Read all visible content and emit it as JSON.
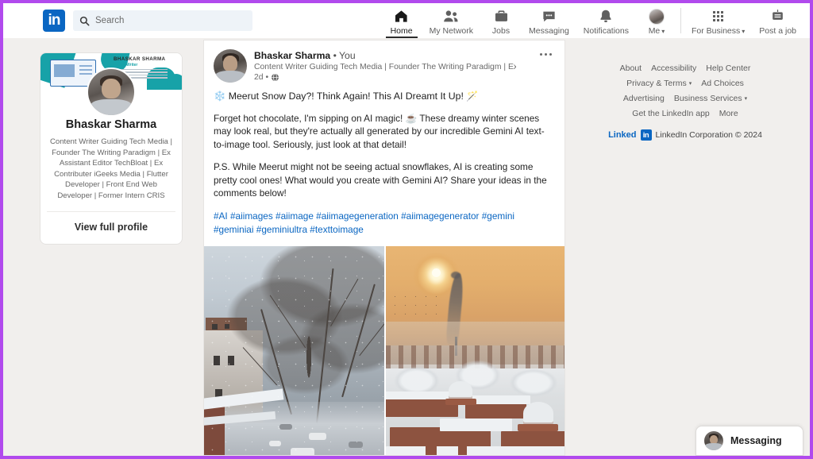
{
  "header": {
    "logo_text": "in",
    "search": {
      "placeholder": "Search",
      "value": ""
    },
    "nav": [
      {
        "label": "Home",
        "icon": "home-icon",
        "active": true
      },
      {
        "label": "My Network",
        "icon": "people-icon",
        "active": false
      },
      {
        "label": "Jobs",
        "icon": "briefcase-icon",
        "active": false
      },
      {
        "label": "Messaging",
        "icon": "chat-bubble-icon",
        "active": false
      },
      {
        "label": "Notifications",
        "icon": "bell-icon",
        "active": false
      },
      {
        "label": "Me",
        "icon": "avatar-icon",
        "active": false,
        "caret": "▾"
      },
      {
        "label": "For Business",
        "icon": "grid-icon",
        "active": false,
        "caret": "▾"
      },
      {
        "label": "Post a job",
        "icon": "post-job-icon",
        "active": false
      }
    ]
  },
  "sidebar": {
    "banner": {
      "name": "BHASKAR SHARMA",
      "subtitle": "Writer"
    },
    "name": "Bhaskar Sharma",
    "headline": "Content Writer Guiding Tech Media | Founder The Writing Paradigm | Ex Assistant Editor TechBloat | Ex Contributer iGeeks Media | Flutter Developer | Front End Web Developer | Former Intern CRIS",
    "view_profile": "View full profile"
  },
  "post": {
    "author": "Bhaskar Sharma",
    "author_suffix": "• You",
    "headline": "Content Writer Guiding Tech Media | Founder The Writing Paradigm | Ex ...",
    "time": "2d •",
    "visibility_icon": "globe-icon",
    "menu_icon": "more-options-icon",
    "title": "❄️ Meerut Snow Day?! Think Again! This AI Dreamt It Up! 🪄",
    "paragraph1": "Forget hot chocolate, I'm sipping on AI magic! ☕ These dreamy winter scenes may look real, but they're actually all generated by our incredible Gemini AI text-to-image tool. Seriously, just look at that detail!",
    "paragraph2": "P.S. While Meerut might not be seeing actual snowflakes, AI is creating some pretty cool ones! What would you create with Gemini AI? Share your ideas in the comments below!",
    "hashtags": "#AI #aiimages #aiimage #aiimagegeneration #aiimagegenerator #gemini #geminiai #geminiultra #texttoimage",
    "images": [
      {
        "alt": "Snowy street scene with bare tree and buildings in cold blue-gray tones"
      },
      {
        "alt": "Golden sunset over snow-covered rooftops and domes with smoke plume"
      }
    ]
  },
  "footer": {
    "row1": [
      {
        "label": "About"
      },
      {
        "label": "Accessibility"
      },
      {
        "label": "Help Center"
      }
    ],
    "row2": [
      {
        "label": "Privacy & Terms",
        "caret": "▾"
      },
      {
        "label": "Ad Choices"
      }
    ],
    "row3": [
      {
        "label": "Advertising"
      },
      {
        "label": "Business Services",
        "caret": "▾"
      }
    ],
    "row4": [
      {
        "label": "Get the LinkedIn app"
      },
      {
        "label": "More"
      }
    ],
    "brand_word": "Linked",
    "brand_box": "in",
    "copyright": "LinkedIn Corporation © 2024"
  },
  "messaging_widget": {
    "label": "Messaging"
  },
  "colors": {
    "brand_blue": "#0a66c2",
    "page_bg": "#f1efed",
    "border_accent": "#b14aed",
    "link_blue": "#0a66c2"
  }
}
